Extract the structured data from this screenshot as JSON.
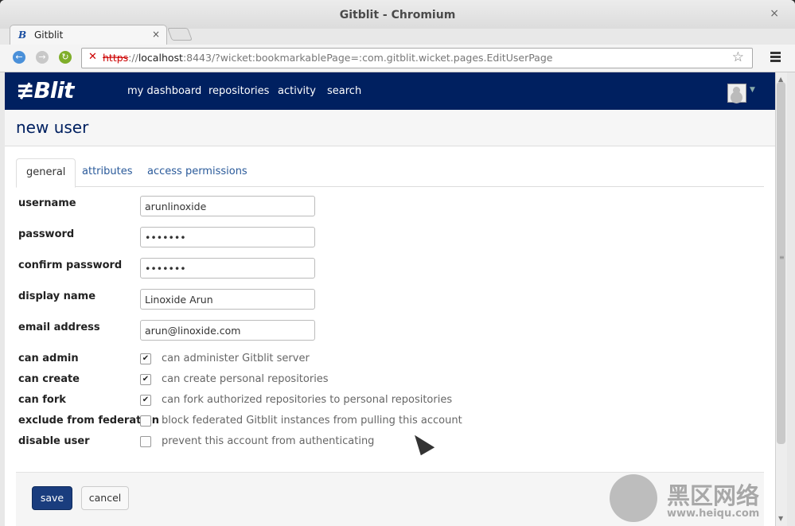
{
  "window": {
    "title": "Gitblit - Chromium",
    "close": "×"
  },
  "tab": {
    "favicon": "B",
    "label": "Gitblit",
    "close": "×"
  },
  "toolbar": {
    "url_scheme": "https",
    "url_host": "localhost",
    "url_rest": ":8443/?wicket:bookmarkablePage=:com.gitblit.wicket.pages.EditUserPage",
    "url_sep": "://",
    "star": "☆",
    "back": "←",
    "forward": "→",
    "reload": "↻",
    "insecure": "✕"
  },
  "navbar": {
    "logo": "Blit",
    "logo_prefix": "≢",
    "links": [
      "my dashboard",
      "repositories",
      "activity",
      "search"
    ]
  },
  "page": {
    "title": "new user"
  },
  "form_tabs": [
    "general",
    "attributes",
    "access permissions"
  ],
  "fields": [
    {
      "label": "username",
      "value": "arunlinoxide"
    },
    {
      "label": "password",
      "value": "•••••••"
    },
    {
      "label": "confirm password",
      "value": "•••••••"
    },
    {
      "label": "display name",
      "value": "Linoxide Arun"
    },
    {
      "label": "email address",
      "value": "arun@linoxide.com"
    }
  ],
  "checkboxes": [
    {
      "label": "can admin",
      "desc": "can administer Gitblit server",
      "checked": "✔"
    },
    {
      "label": "can create",
      "desc": "can create personal repositories",
      "checked": "✔"
    },
    {
      "label": "can fork",
      "desc": "can fork authorized repositories to personal repositories",
      "checked": "✔"
    },
    {
      "label": "exclude from federation",
      "desc": "block federated Gitblit instances from pulling this account",
      "checked": ""
    },
    {
      "label": "disable user",
      "desc": "prevent this account from authenticating",
      "checked": ""
    }
  ],
  "buttons": {
    "save": "save",
    "cancel": "cancel"
  },
  "watermark": {
    "text": "黑区网络",
    "url": "www.heiqu.com"
  }
}
